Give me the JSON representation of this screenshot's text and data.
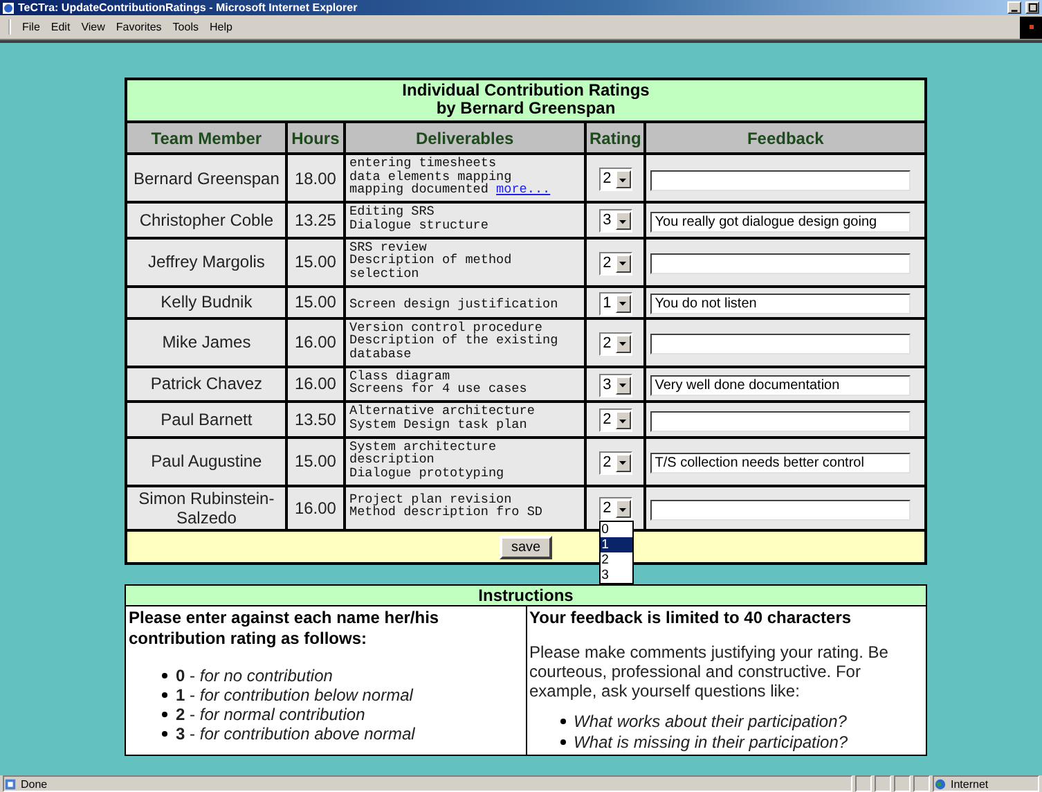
{
  "window": {
    "title": "TeCTra: UpdateContributionRatings - Microsoft Internet Explorer"
  },
  "menu": [
    "File",
    "Edit",
    "View",
    "Favorites",
    "Tools",
    "Help"
  ],
  "form": {
    "title_lines": [
      "Individual Contribution Ratings",
      "by Bernard Greenspan"
    ],
    "columns": [
      "Team Member",
      "Hours",
      "Deliverables",
      "Rating",
      "Feedback"
    ],
    "rows": [
      {
        "member": "Bernard Greenspan",
        "hours": "18.00",
        "deliverables": [
          "entering timesheets",
          "data elements mapping",
          "mapping documented"
        ],
        "link": "more...",
        "rating": "2",
        "feedback": ""
      },
      {
        "member": "Christopher Coble",
        "hours": "13.25",
        "deliverables": [
          "Editing SRS",
          "Dialogue structure"
        ],
        "rating": "3",
        "feedback": "You really got dialogue design going"
      },
      {
        "member": "Jeffrey Margolis",
        "hours": "15.00",
        "deliverables": [
          "SRS review",
          "Description of method",
          "selection"
        ],
        "rating": "2",
        "feedback": ""
      },
      {
        "member": "Kelly Budnik",
        "hours": "15.00",
        "deliverables": [
          "Screen design justification"
        ],
        "rating": "1",
        "feedback": "You do not listen"
      },
      {
        "member": "Mike James",
        "hours": "16.00",
        "deliverables": [
          "Version control procedure",
          "Description of the existing",
          "database"
        ],
        "rating": "2",
        "feedback": ""
      },
      {
        "member": "Patrick Chavez",
        "hours": "16.00",
        "deliverables": [
          "Class diagram",
          "Screens for 4 use cases"
        ],
        "rating": "3",
        "feedback": "Very well done documentation"
      },
      {
        "member": "Paul Barnett",
        "hours": "13.50",
        "deliverables": [
          "Alternative architecture",
          "System Design task plan"
        ],
        "rating": "2",
        "feedback": ""
      },
      {
        "member": "Paul Augustine",
        "hours": "15.00",
        "deliverables": [
          "System architecture",
          "description",
          "Dialogue prototyping"
        ],
        "rating": "2",
        "feedback": "T/S collection needs better control"
      },
      {
        "member": "Simon Rubinstein-Salzedo",
        "hours": "16.00",
        "deliverables": [
          "Project plan revision",
          "Method description fro SD"
        ],
        "rating": "2",
        "feedback": "",
        "open_list": [
          {
            "label": "0",
            "selected": false
          },
          {
            "label": "1",
            "selected": true
          },
          {
            "label": "2",
            "selected": false
          },
          {
            "label": "3",
            "selected": false
          }
        ]
      }
    ],
    "save_button": "save"
  },
  "instructions": {
    "title": "Instructions",
    "left_heading": "Please enter against each name her/his contribution rating as follows:",
    "scale": [
      "**0** - *for no contribution*",
      "**1** - *for contribution below normal*",
      "**2** - *for normal contribution*",
      "**3** - *for contribution above normal*"
    ],
    "right_heading": "Your feedback is limited to 40 characters",
    "paragraph": "Please make comments justifying your rating. Be courteous, professional and constructive. For example, ask yourself questions like:",
    "questions": [
      "What works about their participation?",
      "What is missing in their participation?"
    ]
  },
  "status_bar": {
    "text": "Done",
    "zone": "Internet"
  }
}
